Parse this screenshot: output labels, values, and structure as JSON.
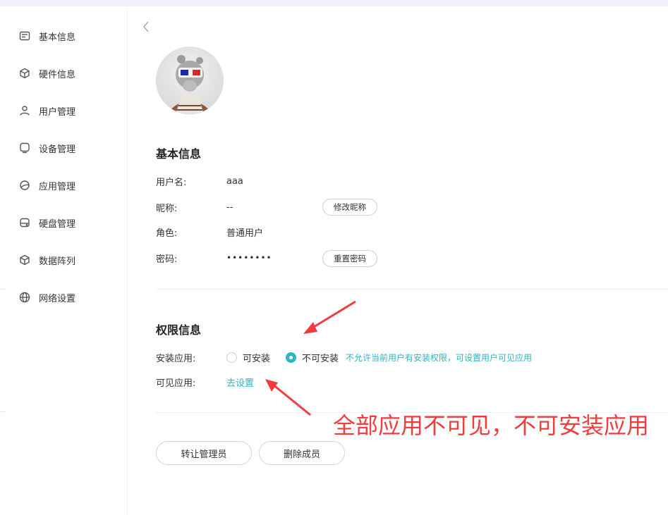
{
  "sidebar": {
    "items": [
      {
        "label": "基本信息",
        "icon": "id-card-icon"
      },
      {
        "label": "硬件信息",
        "icon": "cube-icon"
      },
      {
        "label": "用户管理",
        "icon": "user-icon"
      },
      {
        "label": "设备管理",
        "icon": "device-icon"
      },
      {
        "label": "应用管理",
        "icon": "planet-icon"
      },
      {
        "label": "硬盘管理",
        "icon": "hard-disk-icon"
      },
      {
        "label": "数据阵列",
        "icon": "box-icon"
      },
      {
        "label": "网络设置",
        "icon": "globe-icon"
      }
    ]
  },
  "basic": {
    "title": "基本信息",
    "username_label": "用户名:",
    "username_value": "aaa",
    "nickname_label": "昵称:",
    "nickname_value": "--",
    "edit_nickname_btn": "修改昵称",
    "role_label": "角色:",
    "role_value": "普通用户",
    "password_label": "密码:",
    "password_value": "••••••••",
    "reset_password_btn": "重置密码"
  },
  "permission": {
    "title": "权限信息",
    "install_label": "安装应用:",
    "option_allow": "可安装",
    "option_deny": "不可安装",
    "selected": "不可安装",
    "hint": "不允许当前用户有安装权限，可设置用户可见应用",
    "visible_label": "可见应用:",
    "visible_link": "去设置"
  },
  "actions": {
    "transfer_admin": "转让管理员",
    "remove_member": "删除成员"
  },
  "annotation": {
    "text": "全部应用不可见，不可安装应用",
    "color": "#f03c3c"
  },
  "colors": {
    "accent": "#2bb6c2"
  }
}
